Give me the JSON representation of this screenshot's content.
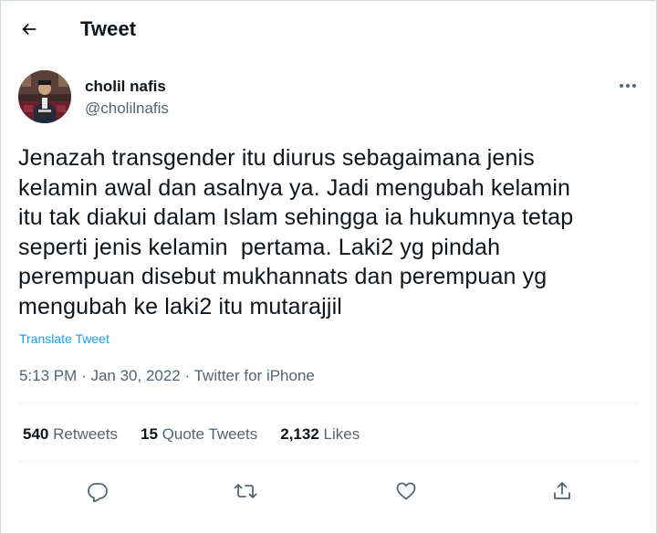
{
  "header": {
    "title": "Tweet",
    "back_icon": "arrow-left-icon"
  },
  "author": {
    "display_name": "cholil nafis",
    "handle": "@cholilnafis"
  },
  "tweet": {
    "text": "Jenazah transgender itu diurus sebagaimana jenis\nkelamin awal dan asalnya ya. Jadi mengubah kelamin\nitu tak diakui dalam Islam sehingga ia hukumnya tetap\nseperti jenis kelamin  pertama. Laki2 yg pindah\nperempuan disebut mukhannats dan perempuan yg\nmengubah ke laki2 itu mutarajjil",
    "translate_label": "Translate Tweet",
    "time": "5:13 PM",
    "date": "Jan 30, 2022",
    "source": "Twitter for iPhone",
    "separator": "·"
  },
  "stats": {
    "retweets_count": "540",
    "retweets_label": "Retweets",
    "quotes_count": "15",
    "quotes_label": "Quote Tweets",
    "likes_count": "2,132",
    "likes_label": "Likes"
  },
  "actions": [
    "reply-icon",
    "retweet-icon",
    "like-icon",
    "share-icon"
  ],
  "colors": {
    "accent": "#1d9bf0",
    "text": "#0f1419",
    "secondary": "#536471",
    "border": "#eff3f4"
  }
}
